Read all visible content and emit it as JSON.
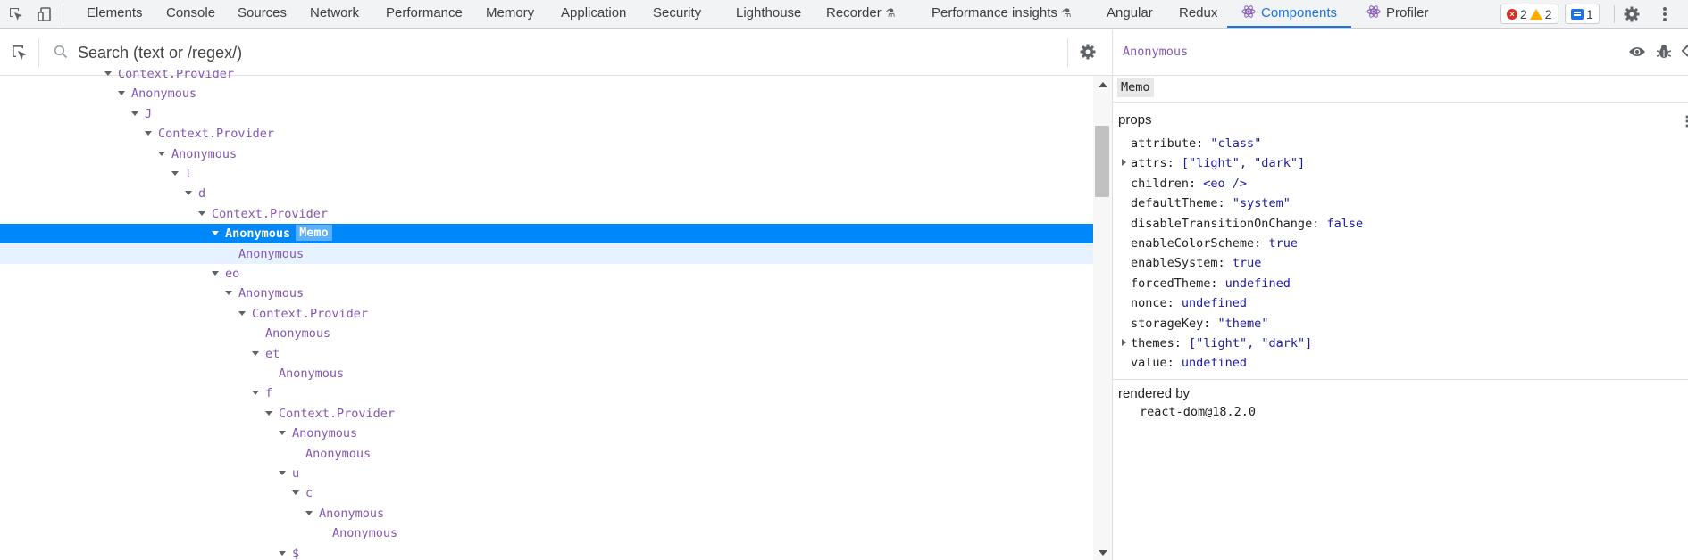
{
  "toolbar": {
    "tabs": [
      {
        "label": "Elements"
      },
      {
        "label": "Console"
      },
      {
        "label": "Sources"
      },
      {
        "label": "Network"
      },
      {
        "label": "Performance"
      },
      {
        "label": "Memory"
      },
      {
        "label": "Application"
      },
      {
        "label": "Security"
      },
      {
        "label": "Lighthouse"
      },
      {
        "label": "Recorder"
      },
      {
        "label": "Performance insights"
      },
      {
        "label": "Angular"
      },
      {
        "label": "Redux"
      },
      {
        "label": "Components"
      },
      {
        "label": "Profiler"
      }
    ],
    "active_tab": "Components",
    "error_count": "2",
    "warning_count": "2",
    "message_count": "1"
  },
  "search": {
    "placeholder": "Search (text or /regex/)"
  },
  "tree": {
    "rows": [
      {
        "label": "Context.Provider",
        "depth": 5,
        "expanded": true
      },
      {
        "label": "Anonymous",
        "depth": 6,
        "expanded": true
      },
      {
        "label": "J",
        "depth": 7,
        "expanded": true
      },
      {
        "label": "Context.Provider",
        "depth": 8,
        "expanded": true
      },
      {
        "label": "Anonymous",
        "depth": 9,
        "expanded": true
      },
      {
        "label": "l",
        "depth": 10,
        "expanded": true
      },
      {
        "label": "d",
        "depth": 11,
        "expanded": true
      },
      {
        "label": "Context.Provider",
        "depth": 12,
        "expanded": true
      },
      {
        "label": "Anonymous",
        "depth": 13,
        "expanded": true,
        "selected": true,
        "badge": "Memo"
      },
      {
        "label": "Anonymous",
        "depth": 14,
        "expanded": false,
        "hover": true
      },
      {
        "label": "eo",
        "depth": 13,
        "expanded": true
      },
      {
        "label": "Anonymous",
        "depth": 14,
        "expanded": true
      },
      {
        "label": "Context.Provider",
        "depth": 15,
        "expanded": true
      },
      {
        "label": "Anonymous",
        "depth": 16,
        "expanded": false
      },
      {
        "label": "et",
        "depth": 16,
        "expanded": true
      },
      {
        "label": "Anonymous",
        "depth": 17,
        "expanded": false
      },
      {
        "label": "f",
        "depth": 16,
        "expanded": true
      },
      {
        "label": "Context.Provider",
        "depth": 17,
        "expanded": true
      },
      {
        "label": "Anonymous",
        "depth": 18,
        "expanded": true
      },
      {
        "label": "Anonymous",
        "depth": 19,
        "expanded": false
      },
      {
        "label": "u",
        "depth": 18,
        "expanded": true
      },
      {
        "label": "c",
        "depth": 19,
        "expanded": true
      },
      {
        "label": "Anonymous",
        "depth": 20,
        "expanded": true
      },
      {
        "label": "Anonymous",
        "depth": 21,
        "expanded": false
      },
      {
        "label": "$",
        "depth": 18,
        "expanded": true
      }
    ]
  },
  "inspector": {
    "title": "Anonymous",
    "memo_label": "Memo",
    "props_title": "props",
    "props": [
      {
        "key": "attribute",
        "value": "\"class\"",
        "expandable": false
      },
      {
        "key": "attrs",
        "value": "[\"light\", \"dark\"]",
        "expandable": true
      },
      {
        "key": "children",
        "value": "<eo />",
        "expandable": false
      },
      {
        "key": "defaultTheme",
        "value": "\"system\"",
        "expandable": false
      },
      {
        "key": "disableTransitionOnChange",
        "value": "false",
        "expandable": false
      },
      {
        "key": "enableColorScheme",
        "value": "true",
        "expandable": false
      },
      {
        "key": "enableSystem",
        "value": "true",
        "expandable": false
      },
      {
        "key": "forcedTheme",
        "value": "undefined",
        "expandable": false
      },
      {
        "key": "nonce",
        "value": "undefined",
        "expandable": false
      },
      {
        "key": "storageKey",
        "value": "\"theme\"",
        "expandable": false
      },
      {
        "key": "themes",
        "value": "[\"light\", \"dark\"]",
        "expandable": true
      },
      {
        "key": "value",
        "value": "undefined",
        "expandable": false
      }
    ],
    "rendered_by_title": "rendered by",
    "rendered_by": "react-dom@18.2.0"
  },
  "colors": {
    "accent": "#1a73e8",
    "selected_row": "#0088fa",
    "component_name": "#8458b3",
    "prop_value": "#1a1aa6"
  }
}
